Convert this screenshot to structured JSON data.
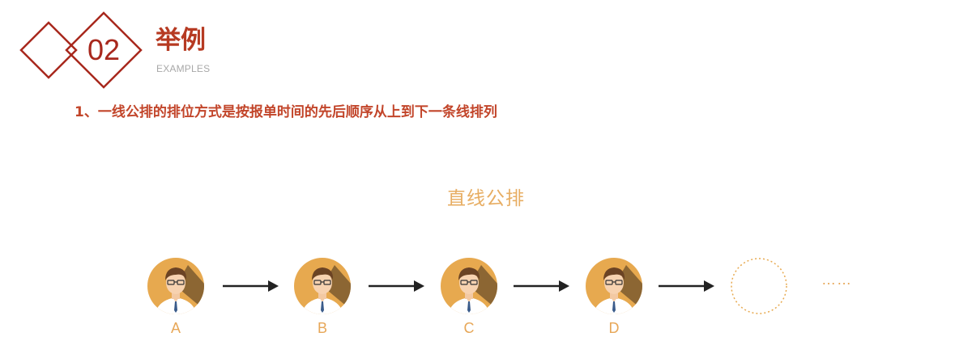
{
  "header": {
    "section_number": "02",
    "title": "举例",
    "subtitle": "EXAMPLES"
  },
  "content": {
    "point": "1、一线公排的排位方式是按报单时间的先后顺序从上到下一条线排列"
  },
  "diagram": {
    "title": "直线公排",
    "nodes": [
      {
        "label": "A"
      },
      {
        "label": "B"
      },
      {
        "label": "C"
      },
      {
        "label": "D"
      }
    ],
    "continuation": "……"
  },
  "colors": {
    "accent_dark": "#a8281d",
    "title_red": "#b63a22",
    "avatar_orange": "#e7a94f",
    "arrow": "#222222"
  }
}
